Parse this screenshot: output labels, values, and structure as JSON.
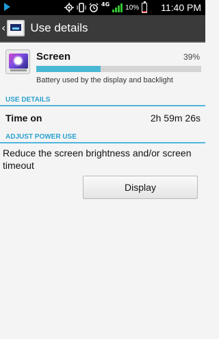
{
  "status_bar": {
    "network_label": "4G",
    "battery_percent": "10%",
    "battery_level": 0.1,
    "time": "11:40 PM",
    "icons": [
      "play-icon",
      "gps-icon",
      "phone-vibrate-icon",
      "alarm-icon",
      "lte-icon",
      "signal-icon",
      "battery-icon"
    ]
  },
  "action_bar": {
    "title": "Use details",
    "app_icon": "display-settings-icon"
  },
  "item": {
    "title": "Screen",
    "percent": "39%",
    "usage_fraction": 0.39,
    "subtitle": "Battery used by the display and backlight",
    "icon": "screen-brightness-icon"
  },
  "use_details": {
    "header": "USE DETAILS",
    "time_on_label": "Time on",
    "time_on_value": "2h 59m 26s"
  },
  "adjust_power": {
    "header": "ADJUST POWER USE",
    "advice": "Reduce the screen brightness and/or screen timeout",
    "button_label": "Display"
  },
  "colors": {
    "accent": "#2aa2cf",
    "progress": "#4ab8d4",
    "action_bar": "#3a3a3a"
  }
}
